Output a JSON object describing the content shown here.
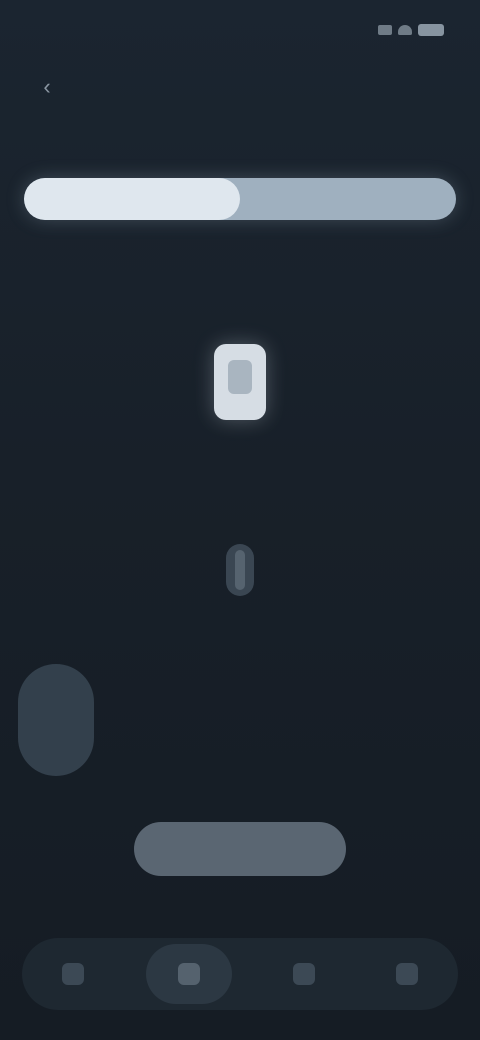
{
  "status_bar": {
    "time": "",
    "icons": [
      "signal-icon",
      "wifi-icon",
      "battery-icon"
    ]
  },
  "header": {
    "back_icon": "back-arrow-icon",
    "title": ""
  },
  "progress": {
    "section_label": "",
    "fill_fraction": 0.5,
    "caption": ""
  },
  "hero": {
    "icon": "phone-icon",
    "message": ""
  },
  "mid": {
    "icon": "microphone-icon",
    "hint": ""
  },
  "picker": {
    "label": "",
    "link": "",
    "days": [
      {
        "name": "",
        "num": "",
        "selected": true
      },
      {
        "name": "",
        "num": "",
        "selected": false
      },
      {
        "name": "",
        "num": "",
        "selected": false
      },
      {
        "name": "",
        "num": "",
        "selected": false
      },
      {
        "name": "",
        "num": "",
        "selected": false
      },
      {
        "name": "",
        "num": "",
        "selected": false
      }
    ]
  },
  "primary_button": {
    "label": ""
  },
  "bottom_nav": {
    "items": [
      {
        "icon": "home-icon",
        "active": false
      },
      {
        "icon": "calendar-icon",
        "active": true
      },
      {
        "icon": "chart-icon",
        "active": false
      },
      {
        "icon": "profile-icon",
        "active": false
      }
    ]
  },
  "colors": {
    "background": "#182029",
    "accent": "#dfe7ee",
    "track": "#9fb0bf",
    "button": "#5a6672"
  }
}
